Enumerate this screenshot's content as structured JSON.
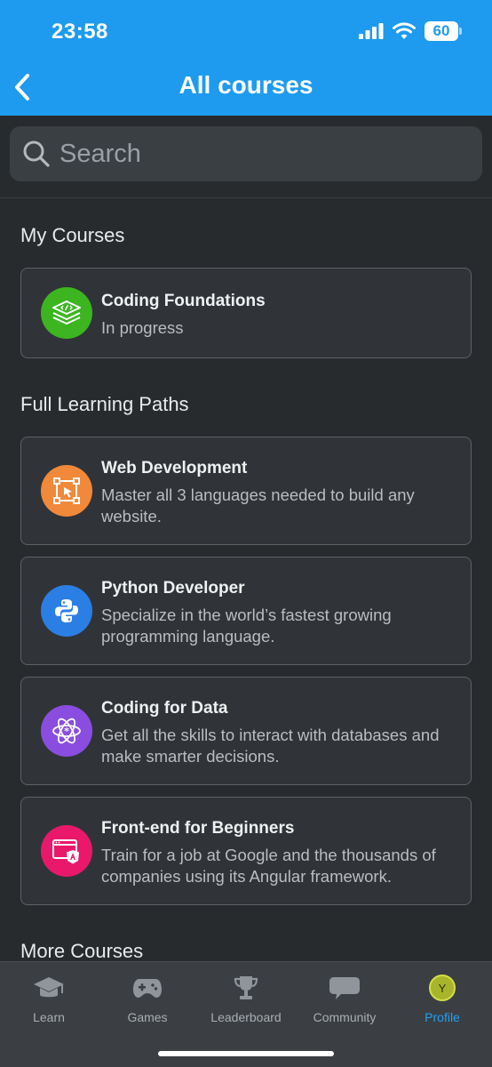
{
  "status_bar": {
    "time": "23:58",
    "battery": "60"
  },
  "header": {
    "title": "All courses"
  },
  "search": {
    "placeholder": "Search"
  },
  "sections": {
    "my_courses": {
      "title": "My Courses",
      "items": [
        {
          "title": "Coding Foundations",
          "desc": "In progress",
          "icon": "code-stack-icon",
          "color": "#3cb521"
        }
      ]
    },
    "learning_paths": {
      "title": "Full Learning Paths",
      "items": [
        {
          "title": "Web Development",
          "desc": "Master all 3 languages needed to build any website.",
          "icon": "cursor-select-icon",
          "color": "#f0893a"
        },
        {
          "title": "Python Developer",
          "desc": "Specialize in the world’s fastest growing programming language.",
          "icon": "python-icon",
          "color": "#2b7ee3"
        },
        {
          "title": "Coding for Data",
          "desc": "Get all the skills to interact with databases and make smarter decisions.",
          "icon": "atom-icon",
          "color": "#8a4de0"
        },
        {
          "title": "Front-end for Beginners",
          "desc": "Train for a job at Google and the thousands of companies using its Angular framework.",
          "icon": "angular-window-icon",
          "color": "#e9186b"
        }
      ]
    },
    "more_courses": {
      "title": "More Courses"
    }
  },
  "tabbar": {
    "tabs": [
      {
        "label": "Learn",
        "icon": "graduation-cap-icon"
      },
      {
        "label": "Games",
        "icon": "gamepad-icon"
      },
      {
        "label": "Leaderboard",
        "icon": "trophy-icon"
      },
      {
        "label": "Community",
        "icon": "chat-bubble-icon"
      },
      {
        "label": "Profile",
        "icon": "avatar-icon",
        "avatar_letter": "Y",
        "active": true
      }
    ]
  }
}
